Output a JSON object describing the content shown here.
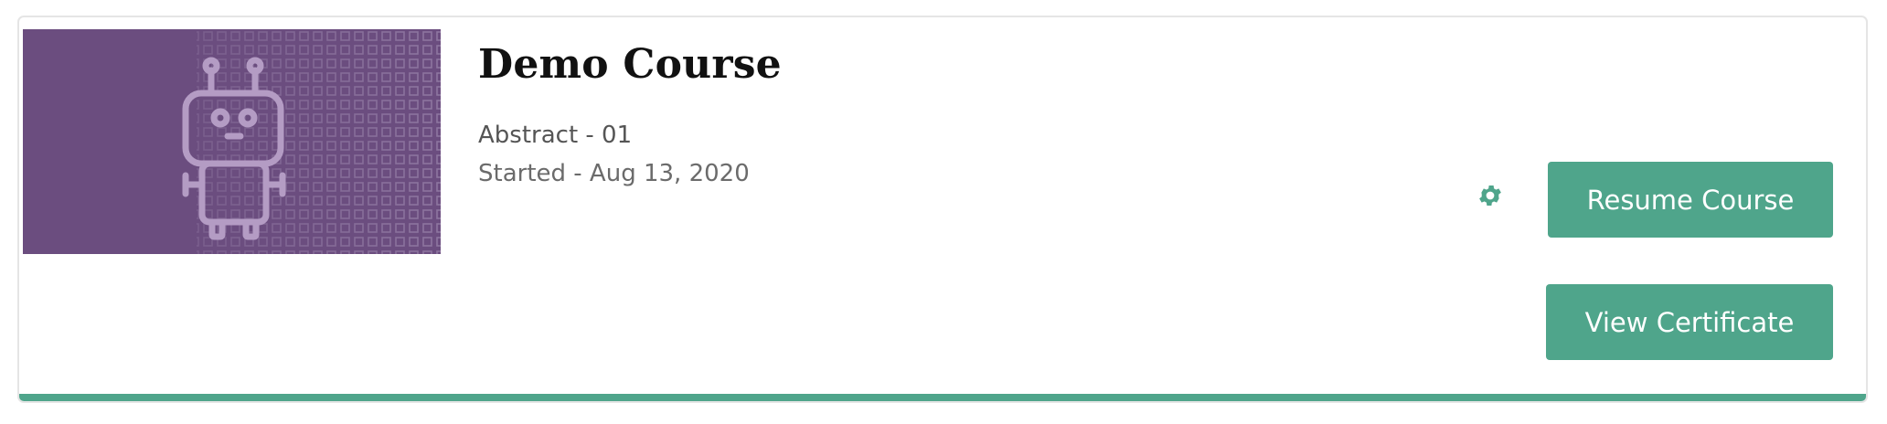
{
  "course": {
    "title": "Demo Course",
    "abstract": "Abstract - 01",
    "started": "Started - Aug 13, 2020"
  },
  "actions": {
    "settings_icon": "gear-icon",
    "resume_label": "Resume Course",
    "certificate_label": "View Certificate"
  },
  "thumbnail": {
    "icon": "robot-icon",
    "background_color": "#6b4d7f"
  },
  "colors": {
    "accent": "#4fa58b",
    "card_border": "#e5e5e5",
    "title": "#111111",
    "meta_text": "#5a5a5a"
  }
}
